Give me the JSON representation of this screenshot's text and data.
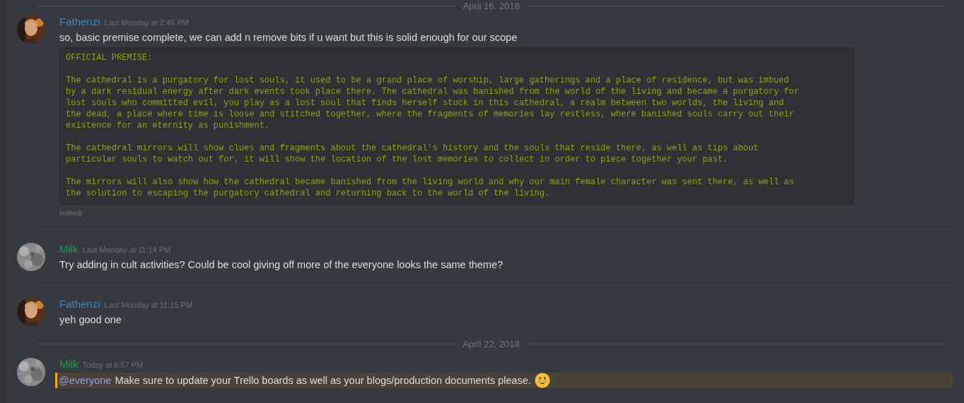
{
  "feed": [
    {
      "kind": "divider",
      "label": "April 16, 2018"
    },
    {
      "kind": "message",
      "author": "Fathenzi",
      "color": "#3a86c8",
      "time": "Last Monday at 2:45 PM",
      "text": "so, basic premise complete, we can add n remove bits if u want but this is solid enough for our scope",
      "code": "OFFICIAL PREMISE:\n\nThe cathedral is a purgatory for lost souls, it used to be a grand place of worship, large gatherings and a place of residence, but was imbued\nby a dark residual energy after dark events took place there. The cathedral was banished from the world of the living and became a purgatory for\nlost souls who committed evil, you play as a lost soul that finds herself stuck in this cathedral, a realm between two worlds, the living and\nthe dead, a place where time is loose and stitched together, where the fragments of memories lay restless, where banished souls carry out their\nexistence for an eternity as punishment.\n\nThe cathedral mirrors will show clues and fragments about the cathedral's history and the souls that reside there, as well as tips about\nparticular souls to watch out for, it will show the location of the lost memories to collect in order to piece together your past.\n\nThe mirrors will also show how the cathedral became banished from the living world and why our main female character was sent there, as well as\nthe solution to escaping the purgatory cathedral and returning back to the world of the living.",
      "edited": "(edited)"
    },
    {
      "kind": "message",
      "author": "Milk",
      "color": "#1f9a52",
      "time": "Last Monday at 11:14 PM",
      "text": "Try adding in cult activities? Could be cool giving off more of the everyone looks the same theme?"
    },
    {
      "kind": "message",
      "author": "Fathenzi",
      "color": "#3a86c8",
      "time": "Last Monday at 11:15 PM",
      "text": "yeh good one"
    },
    {
      "kind": "divider",
      "label": "April 22, 2018"
    },
    {
      "kind": "message",
      "author": "Milk",
      "color": "#1f9a52",
      "time": "Today at 6:57 PM",
      "mention": "@everyone",
      "highlighted": true,
      "text": "Make sure to update your Trello boards as well as your blogs/production documents please.",
      "emoji": true
    }
  ]
}
